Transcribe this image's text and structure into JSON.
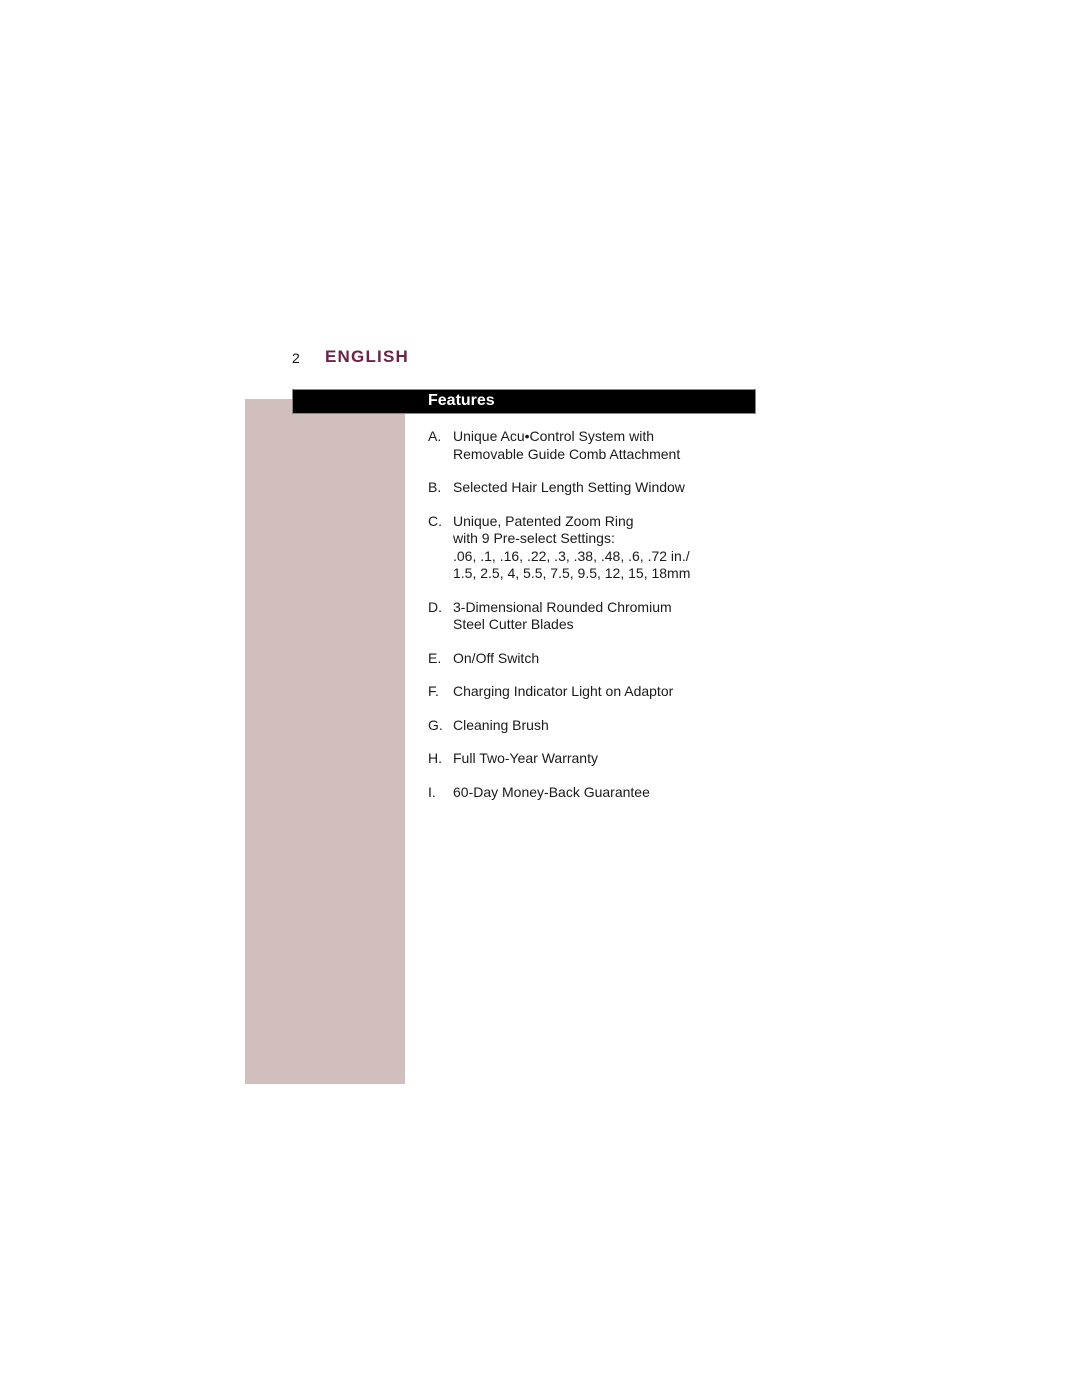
{
  "page": {
    "number": "2",
    "language_heading": "ENGLISH"
  },
  "section": {
    "title": "Features"
  },
  "features": [
    {
      "letter": "A.",
      "lines": [
        "Unique Acu•Control System with",
        "Removable Guide Comb Attachment"
      ]
    },
    {
      "letter": "B.",
      "lines": [
        "Selected Hair Length Setting Window"
      ]
    },
    {
      "letter": "C.",
      "lines": [
        "Unique, Patented Zoom Ring",
        "with 9 Pre-select Settings:",
        ".06, .1, .16, .22, .3, .38, .48, .6, .72 in./",
        "1.5, 2.5, 4, 5.5, 7.5, 9.5, 12, 15, 18mm"
      ]
    },
    {
      "letter": "D.",
      "lines": [
        "3-Dimensional Rounded Chromium",
        "Steel Cutter Blades"
      ]
    },
    {
      "letter": "E.",
      "lines": [
        "On/Off Switch"
      ]
    },
    {
      "letter": "F.",
      "lines": [
        "Charging Indicator Light on Adaptor"
      ]
    },
    {
      "letter": "G.",
      "lines": [
        "Cleaning Brush"
      ]
    },
    {
      "letter": "H.",
      "lines": [
        "Full Two-Year Warranty"
      ]
    },
    {
      "letter": "I.",
      "lines": [
        "60-Day Money-Back Guarantee"
      ]
    }
  ],
  "colors": {
    "heading": "#6b2447",
    "sidebar": "#d1bfbd",
    "header_bar": "#000000",
    "header_text": "#ffffff"
  }
}
